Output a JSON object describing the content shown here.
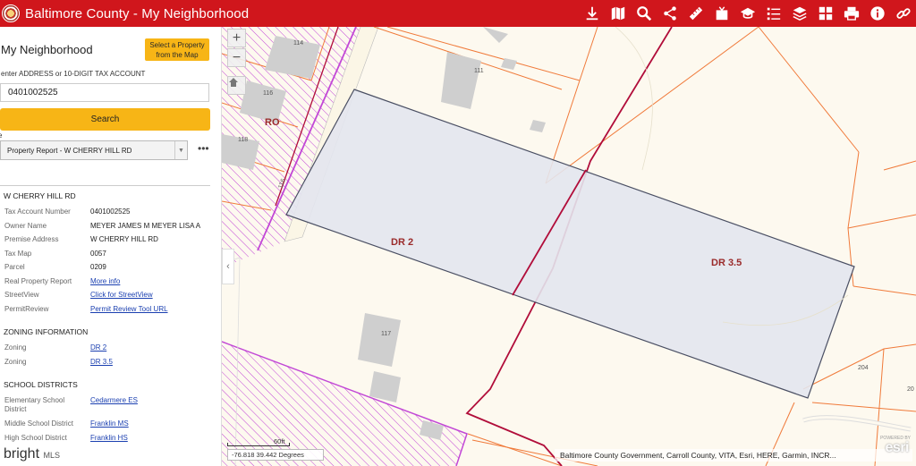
{
  "header": {
    "title": "Baltimore County - My Neighborhood",
    "tools": [
      "download-icon",
      "map-icon",
      "search-icon",
      "share-icon",
      "measure-icon",
      "print-doc-icon",
      "school-icon",
      "list-icon",
      "layers-icon",
      "grid-icon",
      "printer-icon",
      "info-icon",
      "link-icon"
    ]
  },
  "sidebar": {
    "title": "My Neighborhood",
    "select_button": "Select a Property from the Map",
    "address_label": "enter ADDRESS or 10-DIGIT TAX ACCOUNT",
    "address_value": "0401002525",
    "search_button": "Search",
    "select_label": "e",
    "report_selected": "Property Report - W CHERRY HILL RD",
    "more_label": "•••",
    "property": {
      "title": "W CHERRY HILL RD",
      "rows": [
        {
          "k": "Tax Account Number",
          "v": "0401002525"
        },
        {
          "k": "Owner Name",
          "v": "MEYER JAMES M MEYER LISA A"
        },
        {
          "k": "Premise Address",
          "v": "W CHERRY HILL RD"
        },
        {
          "k": "Tax Map",
          "v": "0057"
        },
        {
          "k": "Parcel",
          "v": "0209"
        },
        {
          "k": "Real Property Report",
          "v": "More info"
        },
        {
          "k": "StreetView",
          "v": "Click for StreetView"
        },
        {
          "k": "PermitReview",
          "v": "Permit Review Tool URL"
        }
      ]
    },
    "zoning": {
      "title": "ZONING INFORMATION",
      "rows": [
        {
          "k": "Zoning",
          "v": "DR 2"
        },
        {
          "k": "Zoning",
          "v": "DR 3.5"
        }
      ]
    },
    "schools": {
      "title": "SCHOOL DISTRICTS",
      "rows": [
        {
          "k": "Elementary School District",
          "v": "Cedarmere ES"
        },
        {
          "k": "Middle School District",
          "v": "Franklin MS"
        },
        {
          "k": "High School District",
          "v": "Franklin HS"
        }
      ]
    },
    "watermark": "bright",
    "watermark_small": "MLS"
  },
  "map": {
    "zoom_in": "+",
    "zoom_out": "−",
    "collapse": "‹",
    "coords": "-76.818 39.442 Degrees",
    "scale": "60ft",
    "attribution": "Baltimore County Government, Carroll County, VITA, Esri, HERE, Garmin, INCR...",
    "esri": "esri",
    "powered": "POWERED BY",
    "zones": [
      "DR 2",
      "DR 3.5",
      "RO"
    ],
    "addresses": [
      "114",
      "111",
      "116",
      "118",
      "117",
      "204",
      "20"
    ],
    "road_number": "116"
  },
  "colors": {
    "header": "#d0161c",
    "accent": "#f7b516",
    "parcel_fill": "#e3e6ee",
    "zoning_line": "#c0392b",
    "boundary": "#b10d3a",
    "hatch": "#c247d6"
  }
}
